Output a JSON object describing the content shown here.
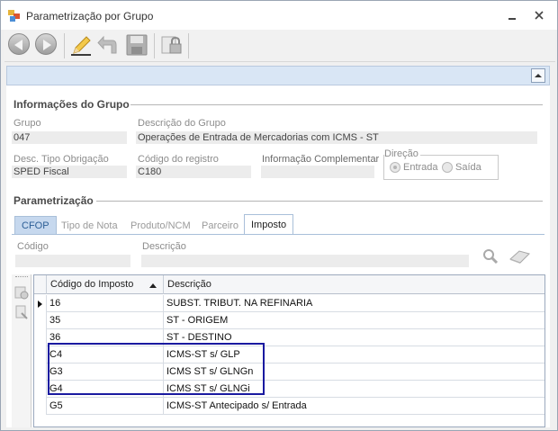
{
  "window": {
    "title": "Parametrização por Grupo"
  },
  "group_info": {
    "section_title": "Informações do Grupo",
    "grupo_label": "Grupo",
    "grupo_value": "047",
    "descricao_label": "Descrição do Grupo",
    "descricao_value": "Operações de Entrada de Mercadorias com ICMS - ST",
    "tipo_obrigacao_label": "Desc. Tipo Obrigação",
    "tipo_obrigacao_value": "SPED Fiscal",
    "codigo_registro_label": "Código do registro",
    "codigo_registro_value": "C180",
    "info_complementar_label": "Informação Complementar",
    "info_complementar_value": "",
    "direcao_label": "Direção",
    "direcao_options": [
      "Entrada",
      "Saída"
    ],
    "direcao_selected": "Entrada"
  },
  "parametrizacao": {
    "section_title": "Parametrização",
    "tabs": [
      "CFOP",
      "Tipo de Nota",
      "Produto/NCM",
      "Parceiro",
      "Imposto"
    ],
    "active_tab": "Imposto",
    "filter": {
      "codigo_label": "Código",
      "descricao_label": "Descrição",
      "codigo_value": "",
      "descricao_value": ""
    }
  },
  "grid": {
    "columns": [
      "Código do Imposto",
      "Descrição"
    ],
    "sort_column": "Código do Imposto",
    "rows": [
      {
        "codigo": "16",
        "descricao": "SUBST. TRIBUT. NA REFINARIA",
        "current": true
      },
      {
        "codigo": "35",
        "descricao": "ST - ORIGEM"
      },
      {
        "codigo": "36",
        "descricao": "ST - DESTINO"
      },
      {
        "codigo": "C4",
        "descricao": "ICMS-ST s/ GLP"
      },
      {
        "codigo": "G3",
        "descricao": "ICMS ST s/ GLNGn"
      },
      {
        "codigo": "G4",
        "descricao": "ICMS ST s/ GLNGi"
      },
      {
        "codigo": "G5",
        "descricao": "ICMS-ST Antecipado s/ Entrada"
      }
    ],
    "highlight_color": "#1a1aa0"
  }
}
